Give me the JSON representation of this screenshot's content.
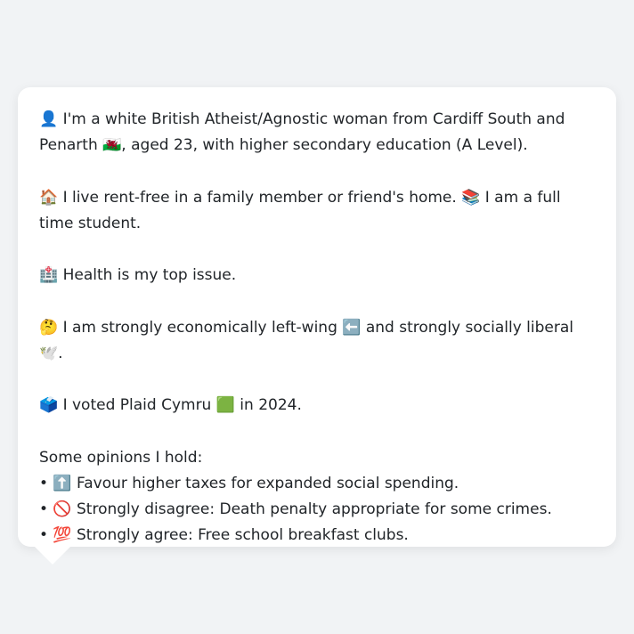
{
  "profile": {
    "intro": "👤 I'm a white British Atheist/Agnostic woman from Cardiff South and Penarth 🏴󠁧󠁢󠁷󠁬󠁳󠁿, aged 23, with higher secondary education (A Level).",
    "housing": "🏠 I live rent-free in a family member or friend's home. 📚 I am a full time student.",
    "issue": "🏥 Health is my top issue.",
    "ideology": "🤔 I am strongly economically left-wing ⬅️ and strongly socially liberal 🕊️.",
    "vote": "🗳️ I voted Plaid Cymru 🟩 in 2024.",
    "opinions_heading": "Some opinions I hold:",
    "opinions": [
      "• ⬆️ Favour higher taxes for expanded social spending.",
      "• 🚫 Strongly disagree: Death penalty appropriate for some crimes.",
      "• 💯 Strongly agree: Free school breakfast clubs."
    ]
  }
}
